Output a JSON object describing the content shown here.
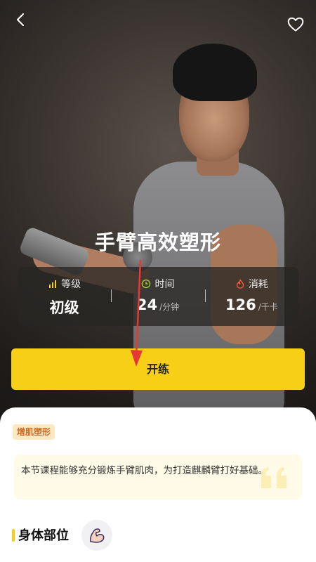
{
  "topbar": {
    "back_icon": "chevron-left-icon",
    "favorite_icon": "heart-outline-icon"
  },
  "course": {
    "title": "手臂高效塑形"
  },
  "stats": [
    {
      "icon": "signal-bars-icon",
      "label": "等级",
      "value": "初级",
      "unit": ""
    },
    {
      "icon": "clock-icon",
      "label": "时间",
      "value": "24",
      "unit": "/分钟"
    },
    {
      "icon": "flame-icon",
      "label": "消耗",
      "value": "126",
      "unit": "/千卡"
    }
  ],
  "start_button": {
    "label": "开练"
  },
  "detail": {
    "tag": "增肌塑形",
    "description": "本节课程能够充分锻炼手臂肌肉，为打造麒麟臂打好基础。",
    "section_title": "身体部位",
    "body_part_icon": "flexed-arm-icon"
  },
  "colors": {
    "accent": "#f7cf16",
    "arrow": "#e53935",
    "tag_text": "#d1691f"
  }
}
